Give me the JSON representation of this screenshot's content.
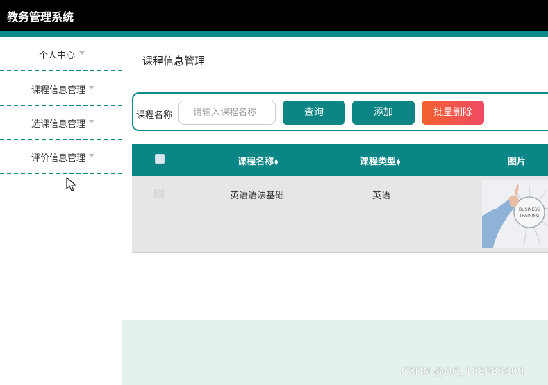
{
  "app": {
    "title": "教务管理系统"
  },
  "sidebar": {
    "items": [
      {
        "label": "个人中心"
      },
      {
        "label": "课程信息管理"
      },
      {
        "label": "选课信息管理"
      },
      {
        "label": "评价信息管理"
      }
    ]
  },
  "main": {
    "page_title": "课程信息管理",
    "search": {
      "label": "课程名称",
      "placeholder": "请输入课程名称",
      "query_button": "查询",
      "add_button": "添加",
      "batch_delete_button": "批量删除"
    },
    "table": {
      "columns": [
        "课程名称",
        "课程类型",
        "图片"
      ],
      "rows": [
        {
          "course_name": "英语语法基础",
          "course_type": "英语",
          "image_text": "BUSINESS TRAINING"
        }
      ]
    }
  },
  "watermark": "CSDN @QQ_188083800",
  "colors": {
    "teal": "#0c8a8a",
    "topbar": "#000000",
    "delete_gradient_start": "#f2612e",
    "delete_gradient_end": "#f04a63"
  },
  "icons": [
    "caret-down-icon",
    "sort-icon",
    "mouse-cursor-icon"
  ]
}
